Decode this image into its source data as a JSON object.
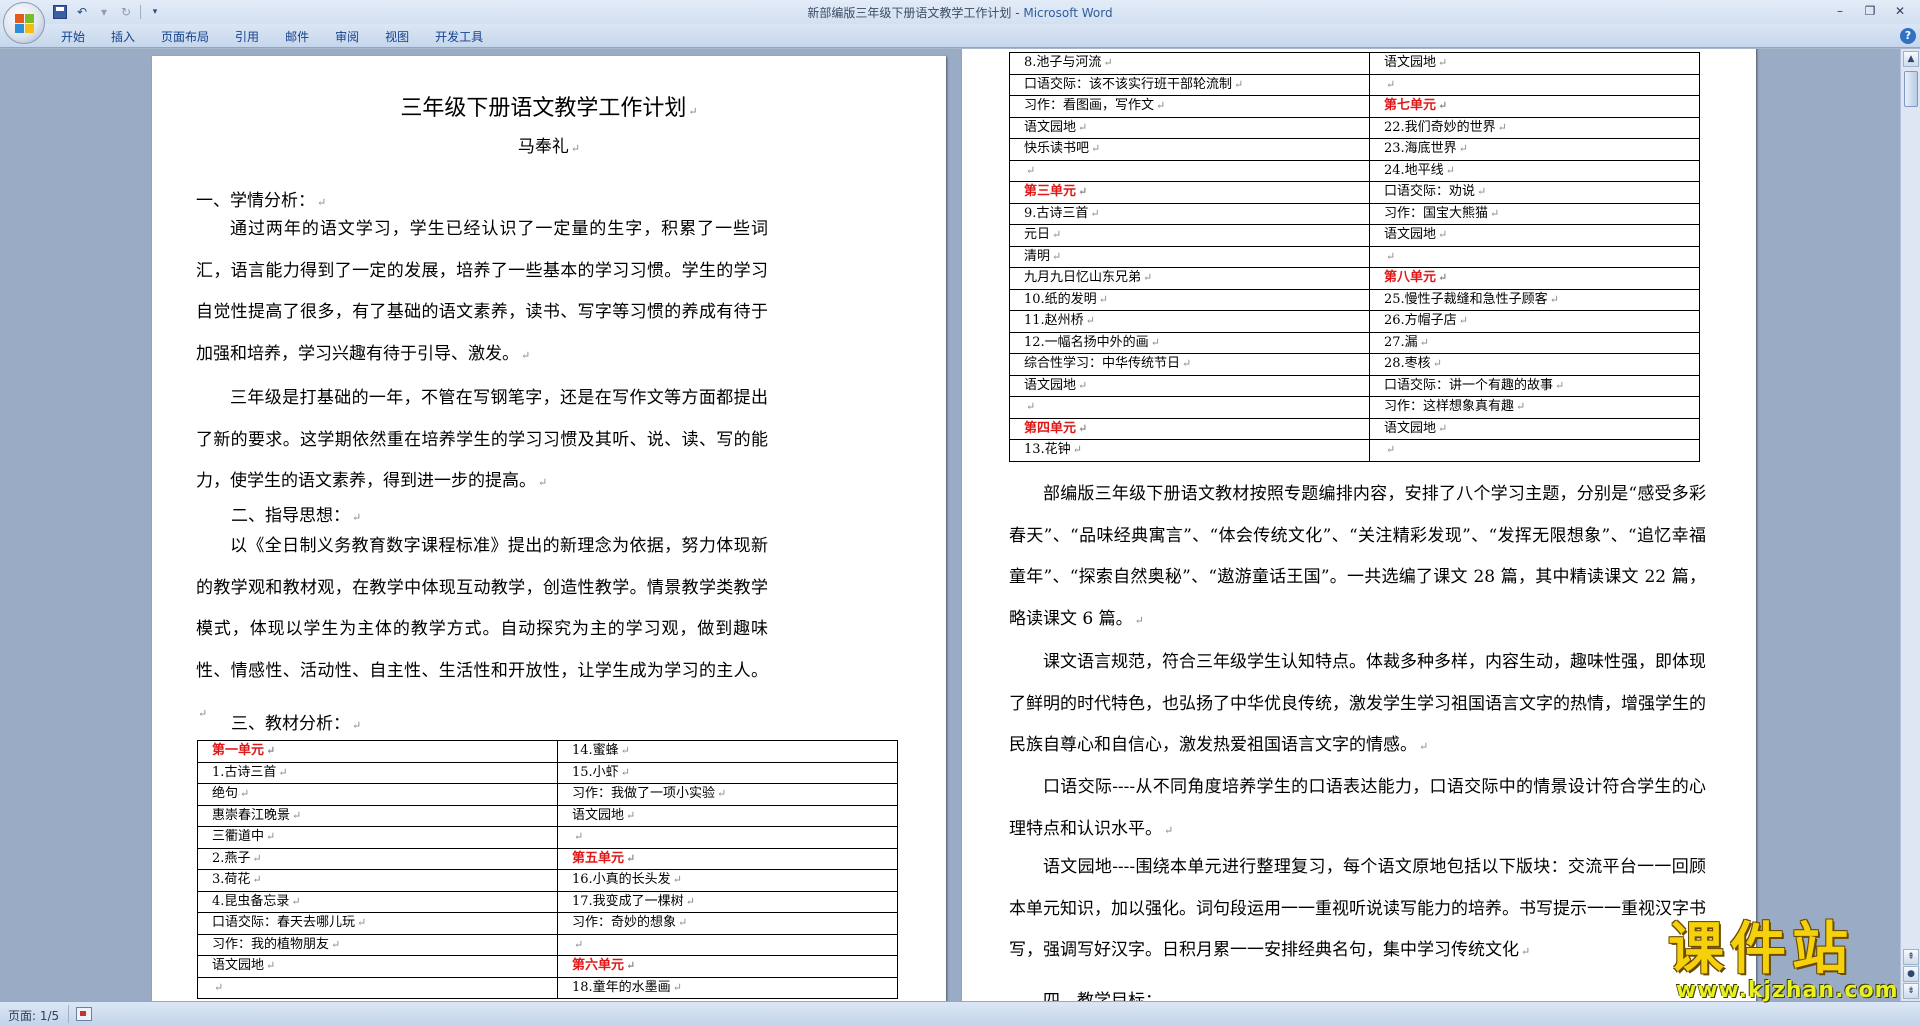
{
  "titlebar": {
    "doc_name": "新部编版三年级下册语文教学工作计划",
    "separator": " - ",
    "app_name": "Microsoft Word"
  },
  "ribbon_tabs": [
    "开始",
    "插入",
    "页面布局",
    "引用",
    "邮件",
    "审阅",
    "视图",
    "开发工具"
  ],
  "status": {
    "page": "页面: 1/5"
  },
  "paragraph_mark": "↵",
  "left_page": {
    "title": "三年级下册语文教学工作计划",
    "author": "马奉礼",
    "section1": "一、学情分析：",
    "para1": "通过两年的语文学习，学生已经认识了一定量的生字，积累了一些词汇，语言能力得到了一定的发展，培养了一些基本的学习习惯。学生的学习自觉性提高了很多，有了基础的语文素养，读书、写字等习惯的养成有待于加强和培养，学习兴趣有待于引导、激发。",
    "para2": "三年级是打基础的一年，不管在写钢笔字，还是在写作文等方面都提出了新的要求。这学期依然重在培养学生的学习习惯及其听、说、读、写的能力，使学生的语文素养，得到进一步的提高。",
    "section2": "二、指导思想：",
    "para3": "以《全日制义务教育数字课程标准》提出的新理念为依据，努力体现新的教学观和教材观，在教学中体现互动教学，创造性教学。情景教学类教学模式，体现以学生为主体的教学方式。自动探究为主的学习观，做到趣味性、情感性、活动性、自主性、生活性和开放性，让学生成为学习的主人。",
    "section3": "三、教材分析：",
    "table": [
      {
        "a": "第一单元",
        "a_red": true,
        "b": "14.蜜蜂"
      },
      {
        "a": "1.古诗三首",
        "b": "15.小虾"
      },
      {
        "a": "绝句",
        "b": "习作：我做了一项小实验"
      },
      {
        "a": "惠崇春江晚景",
        "b": "语文园地"
      },
      {
        "a": "三衢道中",
        "b": ""
      },
      {
        "a": "2.燕子",
        "b": "第五单元",
        "b_red": true
      },
      {
        "a": "3.荷花",
        "b": "16.小真的长头发"
      },
      {
        "a": "4.昆虫备忘录",
        "b": "17.我变成了一棵树"
      },
      {
        "a": "口语交际：春天去哪儿玩",
        "b": "习作：奇妙的想象"
      },
      {
        "a": "习作：我的植物朋友",
        "b": ""
      },
      {
        "a": "语文园地",
        "b": "第六单元",
        "b_red": true
      },
      {
        "a": "",
        "b": "18.童年的水墨画"
      }
    ]
  },
  "right_page": {
    "table": [
      {
        "a": "8.池子与河流",
        "b": "语文园地"
      },
      {
        "a": "口语交际：该不该实行班干部轮流制",
        "b": ""
      },
      {
        "a": "习作：看图画，写作文",
        "b": "第七单元",
        "b_red": true
      },
      {
        "a": "语文园地",
        "b": "22.我们奇妙的世界"
      },
      {
        "a": "快乐读书吧",
        "b": "23.海底世界"
      },
      {
        "a": "",
        "b": "24.地平线"
      },
      {
        "a": "第三单元",
        "a_red": true,
        "b": "口语交际：劝说"
      },
      {
        "a": "9.古诗三首",
        "b": "习作：国宝大熊猫"
      },
      {
        "a": "元日",
        "b": "语文园地"
      },
      {
        "a": "清明",
        "b": ""
      },
      {
        "a": "九月九日忆山东兄弟",
        "b": "第八单元",
        "b_red": true
      },
      {
        "a": "10.纸的发明",
        "b": "25.慢性子裁缝和急性子顾客"
      },
      {
        "a": "11.赵州桥",
        "b": "26.方帽子店"
      },
      {
        "a": "12.一幅名扬中外的画",
        "b": "27.漏"
      },
      {
        "a": "综合性学习：中华传统节日",
        "b": "28.枣核"
      },
      {
        "a": "语文园地",
        "b": "口语交际：讲一个有趣的故事"
      },
      {
        "a": "",
        "b": "习作：这样想象真有趣"
      },
      {
        "a": "第四单元",
        "a_red": true,
        "b": "语文园地"
      },
      {
        "a": "13.花钟",
        "b": ""
      }
    ],
    "para1": "部编版三年级下册语文教材按照专题编排内容，安排了八个学习主题，分别是“感受多彩春天”、“品味经典寓言”、“体会传统文化”、“关注精彩发现”、“发挥无限想象”、“追忆幸福童年”、“探索自然奥秘”、“遨游童话王国”。一共选编了课文 28 篇，其中精读课文 22 篇，略读课文 6 篇。",
    "para2": "课文语言规范，符合三年级学生认知特点。体裁多种多样，内容生动，趣味性强，即体现了鲜明的时代特色，也弘扬了中华优良传统，激发学生学习祖国语言文字的热情，增强学生的民族自尊心和自信心，激发热爱祖国语言文字的情感。",
    "para3": "口语交际----从不同角度培养学生的口语表达能力，口语交际中的情景设计符合学生的心理特点和认识水平。",
    "para4": "语文园地----围绕本单元进行整理复习，每个语文原地包括以下版块：交流平台一一回顾本单元知识，加以强化。词句段运用一一重视听说读写能力的培养。书写提示一一重视汉字书写，强调写好汉字。日积月累一一安排经典名句，集中学习传统文化",
    "section4": "四、教学目标："
  },
  "watermark": {
    "main": "课件站",
    "url": "www.kjzhan.com"
  },
  "colors": {
    "unit_heading": "#e01818",
    "title_text": "#3b4c66",
    "ribbon_text": "#15428b"
  }
}
